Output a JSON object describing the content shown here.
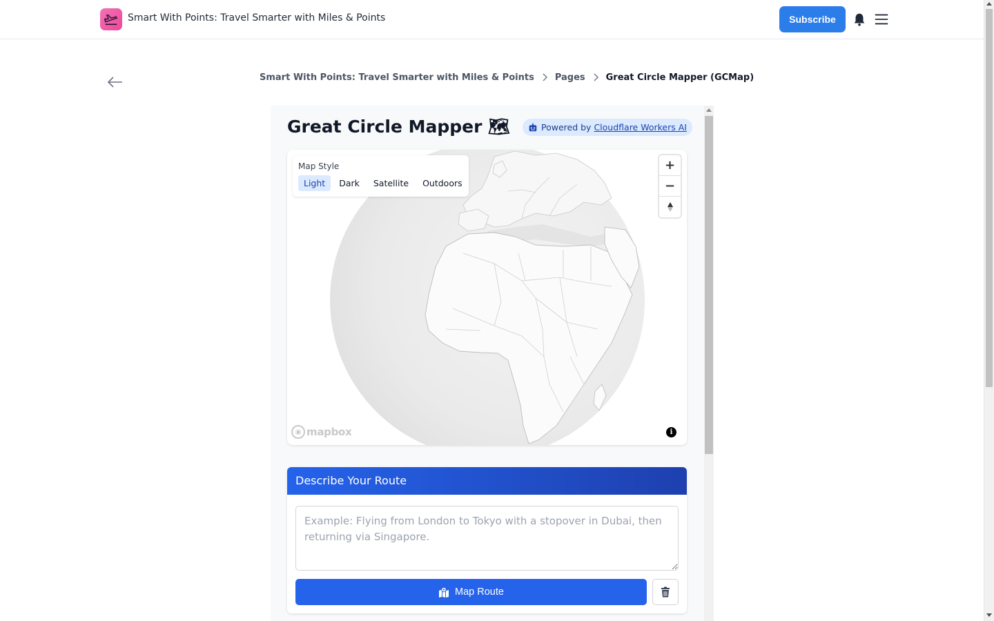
{
  "header": {
    "site_title": "Smart With Points: Travel Smarter with Miles & Points",
    "subscribe_label": "Subscribe",
    "icons": [
      "logo-icon",
      "bell-icon",
      "menu-icon"
    ],
    "accent_color": "#2b7de9"
  },
  "breadcrumb": {
    "items": [
      "Smart With Points: Travel Smarter with Miles & Points",
      "Pages",
      "Great Circle Mapper (GCMap)"
    ]
  },
  "app": {
    "title": "Great Circle Mapper 🗺",
    "powered_prefix": "Powered by",
    "powered_link": "Cloudflare Workers AI",
    "map": {
      "style_label": "Map Style",
      "styles": [
        "Light",
        "Dark",
        "Satellite",
        "Outdoors"
      ],
      "active_style": "Light",
      "attribution": "mapbox",
      "controls": [
        "zoom-in",
        "zoom-out",
        "reset-north"
      ]
    },
    "route": {
      "heading": "Describe Your Route",
      "placeholder": "Example: Flying from London to Tokyo with a stopover in Dubai, then returning via Singapore.",
      "value": "",
      "map_button": "Map Route",
      "header_gradient": [
        "#2563eb",
        "#1e40af"
      ]
    }
  }
}
